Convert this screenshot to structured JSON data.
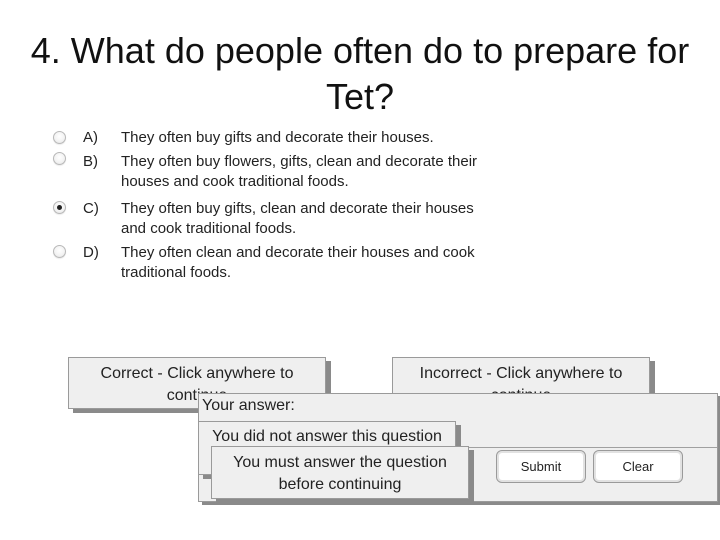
{
  "question": {
    "title": "4. What do people often do to prepare for Tet?",
    "options": [
      {
        "letter": "A)",
        "text": "They often buy gifts and decorate their houses.",
        "selected": false
      },
      {
        "letter": "B)",
        "text": "They often buy flowers, gifts, clean and decorate their houses and cook traditional foods.",
        "selected": false
      },
      {
        "letter": "C)",
        "text": "They often buy gifts, clean and decorate their houses and cook traditional foods.",
        "selected": true
      },
      {
        "letter": "D)",
        "text": "They often clean and decorate their houses and cook traditional foods.",
        "selected": false
      }
    ]
  },
  "feedback": {
    "correct": "Correct - Click anywhere to continue",
    "incorrect": "Incorrect - Click anywhere to continue",
    "not_answered": "You did not answer this question completely",
    "must_answer": "You must answer the question before continuing"
  },
  "answer_panel": {
    "label": "Your answer:",
    "submit_label": "Submit",
    "clear_label": "Clear"
  }
}
